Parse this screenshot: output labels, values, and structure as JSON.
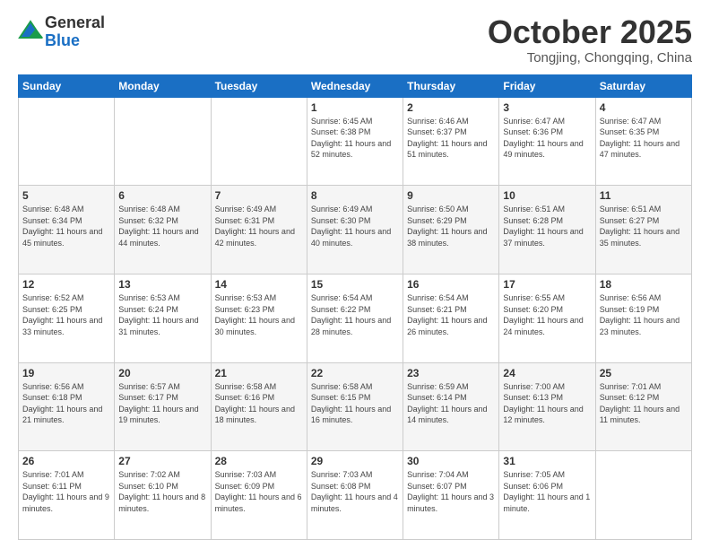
{
  "logo": {
    "general": "General",
    "blue": "Blue"
  },
  "header": {
    "month": "October 2025",
    "location": "Tongjing, Chongqing, China"
  },
  "weekdays": [
    "Sunday",
    "Monday",
    "Tuesday",
    "Wednesday",
    "Thursday",
    "Friday",
    "Saturday"
  ],
  "weeks": [
    [
      {
        "day": "",
        "info": ""
      },
      {
        "day": "",
        "info": ""
      },
      {
        "day": "",
        "info": ""
      },
      {
        "day": "1",
        "info": "Sunrise: 6:45 AM\nSunset: 6:38 PM\nDaylight: 11 hours\nand 52 minutes."
      },
      {
        "day": "2",
        "info": "Sunrise: 6:46 AM\nSunset: 6:37 PM\nDaylight: 11 hours\nand 51 minutes."
      },
      {
        "day": "3",
        "info": "Sunrise: 6:47 AM\nSunset: 6:36 PM\nDaylight: 11 hours\nand 49 minutes."
      },
      {
        "day": "4",
        "info": "Sunrise: 6:47 AM\nSunset: 6:35 PM\nDaylight: 11 hours\nand 47 minutes."
      }
    ],
    [
      {
        "day": "5",
        "info": "Sunrise: 6:48 AM\nSunset: 6:34 PM\nDaylight: 11 hours\nand 45 minutes."
      },
      {
        "day": "6",
        "info": "Sunrise: 6:48 AM\nSunset: 6:32 PM\nDaylight: 11 hours\nand 44 minutes."
      },
      {
        "day": "7",
        "info": "Sunrise: 6:49 AM\nSunset: 6:31 PM\nDaylight: 11 hours\nand 42 minutes."
      },
      {
        "day": "8",
        "info": "Sunrise: 6:49 AM\nSunset: 6:30 PM\nDaylight: 11 hours\nand 40 minutes."
      },
      {
        "day": "9",
        "info": "Sunrise: 6:50 AM\nSunset: 6:29 PM\nDaylight: 11 hours\nand 38 minutes."
      },
      {
        "day": "10",
        "info": "Sunrise: 6:51 AM\nSunset: 6:28 PM\nDaylight: 11 hours\nand 37 minutes."
      },
      {
        "day": "11",
        "info": "Sunrise: 6:51 AM\nSunset: 6:27 PM\nDaylight: 11 hours\nand 35 minutes."
      }
    ],
    [
      {
        "day": "12",
        "info": "Sunrise: 6:52 AM\nSunset: 6:25 PM\nDaylight: 11 hours\nand 33 minutes."
      },
      {
        "day": "13",
        "info": "Sunrise: 6:53 AM\nSunset: 6:24 PM\nDaylight: 11 hours\nand 31 minutes."
      },
      {
        "day": "14",
        "info": "Sunrise: 6:53 AM\nSunset: 6:23 PM\nDaylight: 11 hours\nand 30 minutes."
      },
      {
        "day": "15",
        "info": "Sunrise: 6:54 AM\nSunset: 6:22 PM\nDaylight: 11 hours\nand 28 minutes."
      },
      {
        "day": "16",
        "info": "Sunrise: 6:54 AM\nSunset: 6:21 PM\nDaylight: 11 hours\nand 26 minutes."
      },
      {
        "day": "17",
        "info": "Sunrise: 6:55 AM\nSunset: 6:20 PM\nDaylight: 11 hours\nand 24 minutes."
      },
      {
        "day": "18",
        "info": "Sunrise: 6:56 AM\nSunset: 6:19 PM\nDaylight: 11 hours\nand 23 minutes."
      }
    ],
    [
      {
        "day": "19",
        "info": "Sunrise: 6:56 AM\nSunset: 6:18 PM\nDaylight: 11 hours\nand 21 minutes."
      },
      {
        "day": "20",
        "info": "Sunrise: 6:57 AM\nSunset: 6:17 PM\nDaylight: 11 hours\nand 19 minutes."
      },
      {
        "day": "21",
        "info": "Sunrise: 6:58 AM\nSunset: 6:16 PM\nDaylight: 11 hours\nand 18 minutes."
      },
      {
        "day": "22",
        "info": "Sunrise: 6:58 AM\nSunset: 6:15 PM\nDaylight: 11 hours\nand 16 minutes."
      },
      {
        "day": "23",
        "info": "Sunrise: 6:59 AM\nSunset: 6:14 PM\nDaylight: 11 hours\nand 14 minutes."
      },
      {
        "day": "24",
        "info": "Sunrise: 7:00 AM\nSunset: 6:13 PM\nDaylight: 11 hours\nand 12 minutes."
      },
      {
        "day": "25",
        "info": "Sunrise: 7:01 AM\nSunset: 6:12 PM\nDaylight: 11 hours\nand 11 minutes."
      }
    ],
    [
      {
        "day": "26",
        "info": "Sunrise: 7:01 AM\nSunset: 6:11 PM\nDaylight: 11 hours\nand 9 minutes."
      },
      {
        "day": "27",
        "info": "Sunrise: 7:02 AM\nSunset: 6:10 PM\nDaylight: 11 hours\nand 8 minutes."
      },
      {
        "day": "28",
        "info": "Sunrise: 7:03 AM\nSunset: 6:09 PM\nDaylight: 11 hours\nand 6 minutes."
      },
      {
        "day": "29",
        "info": "Sunrise: 7:03 AM\nSunset: 6:08 PM\nDaylight: 11 hours\nand 4 minutes."
      },
      {
        "day": "30",
        "info": "Sunrise: 7:04 AM\nSunset: 6:07 PM\nDaylight: 11 hours\nand 3 minutes."
      },
      {
        "day": "31",
        "info": "Sunrise: 7:05 AM\nSunset: 6:06 PM\nDaylight: 11 hours\nand 1 minute."
      },
      {
        "day": "",
        "info": ""
      }
    ]
  ]
}
